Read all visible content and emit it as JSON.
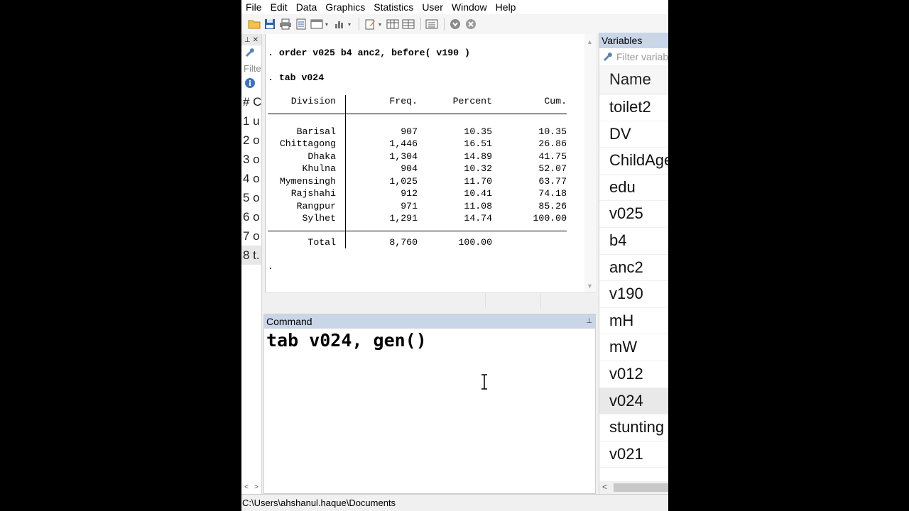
{
  "menu": [
    "File",
    "Edit",
    "Data",
    "Graphics",
    "Statistics",
    "User",
    "Window",
    "Help"
  ],
  "history": {
    "filter_placeholder": "Filte",
    "header": "# C",
    "rows": [
      "1 u",
      "2 o",
      "3 o",
      "4 o",
      "5 o",
      "6 o",
      "7 o",
      "8 t."
    ]
  },
  "results": {
    "lines": [
      ". order v025 b4 anc2, before( v190 )",
      ". tab v024"
    ],
    "table": {
      "headers": [
        "Division",
        "Freq.",
        "Percent",
        "Cum."
      ],
      "rows": [
        [
          "Barisal",
          "907",
          "10.35",
          "10.35"
        ],
        [
          "Chittagong",
          "1,446",
          "16.51",
          "26.86"
        ],
        [
          "Dhaka",
          "1,304",
          "14.89",
          "41.75"
        ],
        [
          "Khulna",
          "904",
          "10.32",
          "52.07"
        ],
        [
          "Mymensingh",
          "1,025",
          "11.70",
          "63.77"
        ],
        [
          "Rajshahi",
          "912",
          "10.41",
          "74.18"
        ],
        [
          "Rangpur",
          "971",
          "11.08",
          "85.26"
        ],
        [
          "Sylhet",
          "1,291",
          "14.74",
          "100.00"
        ]
      ],
      "total": [
        "Total",
        "8,760",
        "100.00",
        ""
      ]
    },
    "prompt": "."
  },
  "command": {
    "title": "Command",
    "text": "tab v024, gen()"
  },
  "variables": {
    "title": "Variables",
    "filter_placeholder": "Filter variables here",
    "column": "Name",
    "items": [
      "toilet2",
      "DV",
      "ChildAge",
      "edu",
      "v025",
      "b4",
      "anc2",
      "v190",
      "mH",
      "mW",
      "v012",
      "v024",
      "stunting",
      "v021"
    ],
    "selected_index": 11
  },
  "status": {
    "path": "C:\\Users\\ahshanul.haque\\Documents"
  },
  "colors": {
    "pane_header": "#c9d6e8",
    "chrome": "#f0f0f0"
  }
}
